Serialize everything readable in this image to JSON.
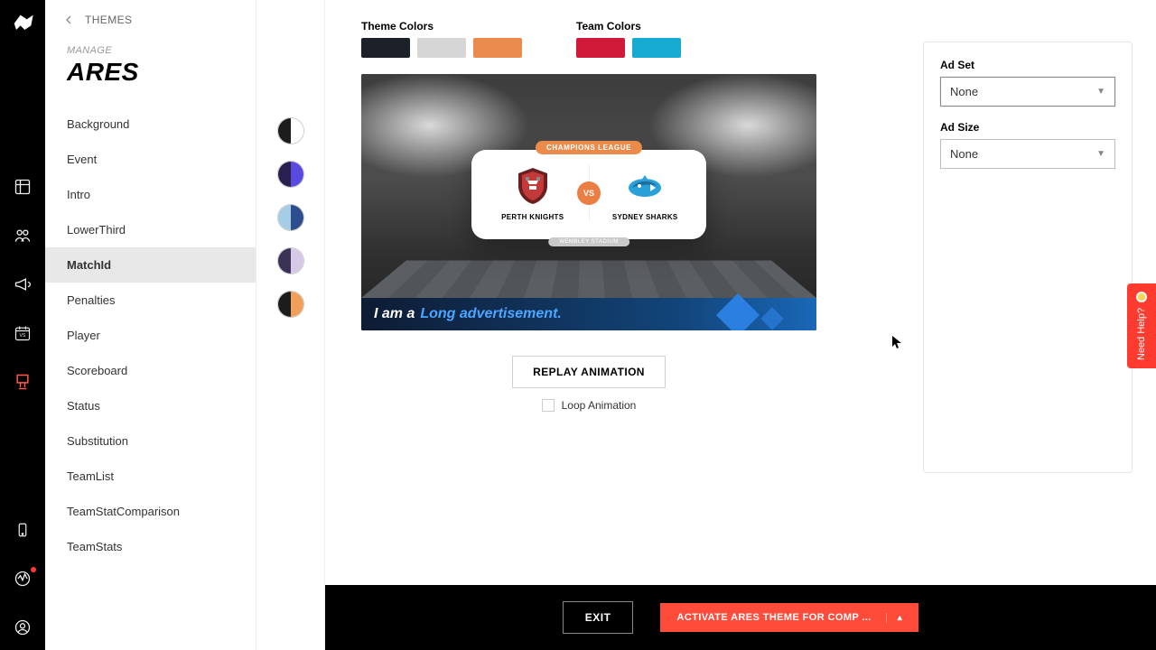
{
  "header": {
    "back_label": "THEMES",
    "manage_label": "MANAGE",
    "theme_name": "ARES"
  },
  "sidebar": {
    "items": [
      {
        "label": "Background"
      },
      {
        "label": "Event"
      },
      {
        "label": "Intro"
      },
      {
        "label": "LowerThird"
      },
      {
        "label": "MatchId"
      },
      {
        "label": "Penalties"
      },
      {
        "label": "Player"
      },
      {
        "label": "Scoreboard"
      },
      {
        "label": "Status"
      },
      {
        "label": "Substitution"
      },
      {
        "label": "TeamList"
      },
      {
        "label": "TeamStatComparison"
      },
      {
        "label": "TeamStats"
      }
    ],
    "active_index": 4
  },
  "variants": [
    {
      "left": "#1c1c1c",
      "right": "#ffffff"
    },
    {
      "left": "#2a2050",
      "right": "#5a4be0"
    },
    {
      "left": "#a6cde6",
      "right": "#2d4e8c"
    },
    {
      "left": "#3b3356",
      "right": "#d6c9e8"
    },
    {
      "left": "#1c1c1c",
      "right": "#f0a05a"
    }
  ],
  "swatches": {
    "theme_label": "Theme Colors",
    "team_label": "Team Colors",
    "theme": [
      "#1c2029",
      "#d6d6d6",
      "#eb8b4b"
    ],
    "team": [
      "#d11a3a",
      "#16a9d1"
    ]
  },
  "preview": {
    "league": "CHAMPIONS LEAGUE",
    "vs": "VS",
    "team_a": "PERTH KNIGHTS",
    "team_b": "SYDNEY SHARKS",
    "venue": "WEMBLEY STADIUM",
    "ad_prefix": "I am a",
    "ad_highlight": "Long advertisement."
  },
  "controls": {
    "replay": "REPLAY ANIMATION",
    "loop": "Loop Animation"
  },
  "right": {
    "adset_label": "Ad Set",
    "adset_value": "None",
    "adsize_label": "Ad Size",
    "adsize_value": "None"
  },
  "footer": {
    "exit": "EXIT",
    "activate": "ACTIVATE ARES THEME FOR COMP ..."
  },
  "help": {
    "label": "Need Help?"
  }
}
